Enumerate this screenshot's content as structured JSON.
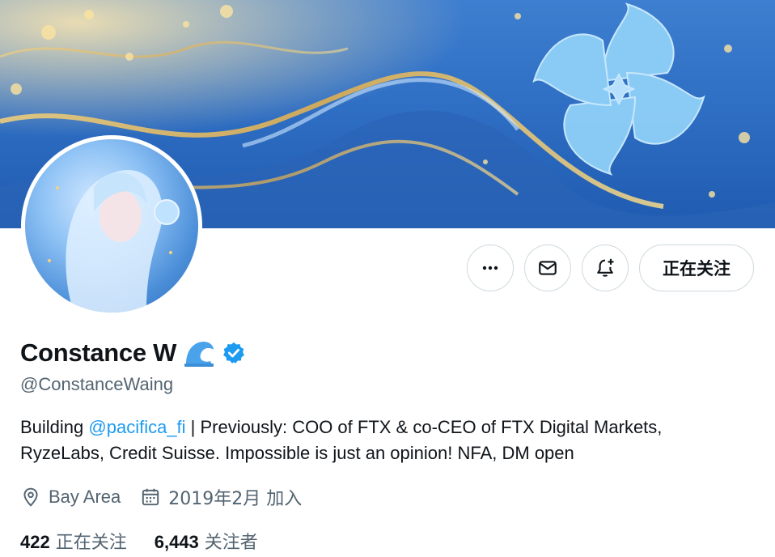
{
  "profile": {
    "display_name": "Constance W",
    "handle": "@ConstanceWaing",
    "bio": {
      "prefix": "Building ",
      "mention": "@pacifica_fi",
      "rest_line1": " | Previously: COO of FTX & co-CEO of FTX Digital Markets,",
      "line2": "RyzeLabs, Credit Suisse. Impossible is just an opinion! NFA, DM open"
    },
    "location": "Bay Area",
    "joined": "2019年2月 加入",
    "following_count": "422",
    "following_label": "正在关注",
    "followers_count": "6,443",
    "followers_label": "关注者"
  },
  "actions": {
    "follow_label": "正在关注"
  },
  "icons": {
    "more": "more-icon",
    "message": "mail-icon",
    "notify": "bell-plus-icon",
    "verified": "verified-badge-icon",
    "wave": "wave-emoji-icon",
    "location": "location-pin-icon",
    "calendar": "calendar-icon"
  },
  "colors": {
    "accent": "#1d9bf0",
    "text": "#0f1419",
    "muted": "#536471"
  }
}
